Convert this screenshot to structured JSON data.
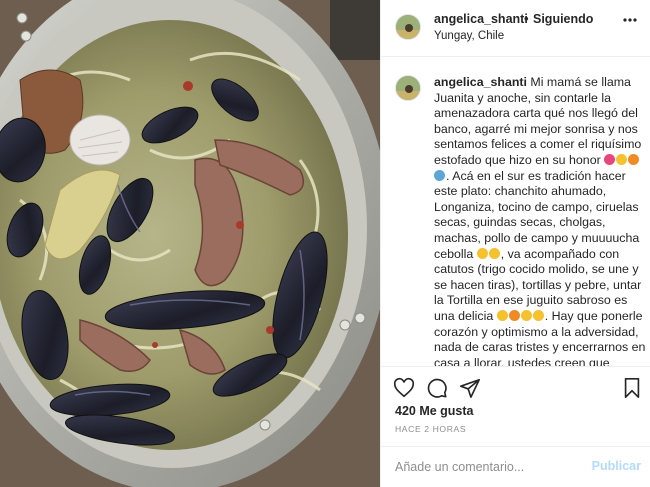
{
  "post": {
    "photo_alt": "Estofado con choritos y longaniza en una olla"
  },
  "header": {
    "username": "angelica_shanti",
    "separator": "•",
    "follow_status": "Siguiendo",
    "location": "Yungay, Chile",
    "more_icon": "more-horizontal-icon"
  },
  "caption": {
    "username": "angelica_shanti",
    "segments": [
      " Mi mamá se llama Juanita y anoche, sin contarle la amenazadora carta qué nos llegó del banco, agarré mi mejor sonrisa y nos sentamos felices a comer el riquísimo estofado que hizo en su honor ",
      ". Acá en el sur es tradición hacer este plato: chanchito ahumado, Longaniza, tocino de campo, ciruelas secas, guindas secas, cholgas, machas, pollo de campo y muuuucha cebolla ",
      ", va acompañado con catutos (trigo cocido molido, se une y se hacen tiras), tortillas y pebre, untar la Tortilla en ese juguito sabroso es una delicia ",
      ". Hay que ponerle corazón y optimismo a la adversidad, nada de caras tristes y encerrarnos en casa a llorar, ustedes creen que anoche dormí??? Busqué información, hice consultas, encontré"
    ],
    "emoji_colors": [
      "#e8457c",
      "#f6c12f",
      "#f08a24",
      "#5fa6d8",
      "#f6c12f"
    ]
  },
  "actions": {
    "like_icon": "heart-icon",
    "comment_icon": "comment-icon",
    "share_icon": "share-icon",
    "save_icon": "bookmark-icon",
    "likes": "420 Me gusta",
    "time": "HACE 2 HORAS"
  },
  "comment": {
    "placeholder": "Añade un comentario...",
    "publish_label": "Publicar",
    "publish_color": "#b3dbff"
  }
}
